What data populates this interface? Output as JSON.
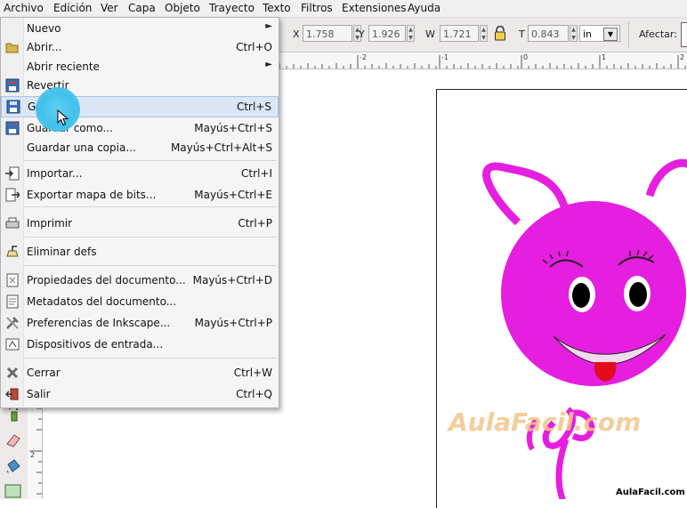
{
  "menubar": {
    "items": [
      "Archivo",
      "Edición",
      "Ver",
      "Capa",
      "Objeto",
      "Trayecto",
      "Texto",
      "Filtros",
      "Extensiones",
      "Ayuda"
    ]
  },
  "toolbar": {
    "x_label": "X",
    "x_value": "1.758",
    "y_label": "Y",
    "y_value": "1.926",
    "w_label": "W",
    "w_value": "1.721",
    "h_label": "T",
    "h_value": "0.843",
    "unit": "in",
    "affect_label": "Afectar:"
  },
  "ruler": {
    "h_labels": [
      "-2",
      "-1",
      "0",
      "1",
      "2"
    ],
    "v_labels": [
      "2"
    ]
  },
  "menu": {
    "items": [
      {
        "label": "Nuevo",
        "shortcut": "",
        "submenu": true,
        "icon": "none"
      },
      {
        "label": "Abrir...",
        "shortcut": "Ctrl+O",
        "submenu": false,
        "icon": "folder-open-icon"
      },
      {
        "label": "Abrir reciente",
        "shortcut": "",
        "submenu": true,
        "icon": "none"
      },
      {
        "label": "Revertir",
        "shortcut": "",
        "submenu": false,
        "icon": "revert-icon"
      },
      {
        "label": "Guardar",
        "shortcut": "Ctrl+S",
        "submenu": false,
        "icon": "save-icon",
        "highlighted": true
      },
      {
        "label": "Guardar como...",
        "shortcut": "Mayús+Ctrl+S",
        "submenu": false,
        "icon": "save-as-icon"
      },
      {
        "label": "Guardar una copia...",
        "shortcut": "Mayús+Ctrl+Alt+S",
        "submenu": false,
        "icon": "none"
      },
      {
        "label": "Importar...",
        "shortcut": "Ctrl+I",
        "submenu": false,
        "icon": "import-icon"
      },
      {
        "label": "Exportar mapa de bits...",
        "shortcut": "Mayús+Ctrl+E",
        "submenu": false,
        "icon": "export-icon"
      },
      {
        "label": "Imprimir",
        "shortcut": "Ctrl+P",
        "submenu": false,
        "icon": "print-icon"
      },
      {
        "label": "Eliminar defs",
        "shortcut": "",
        "submenu": false,
        "icon": "vacuum-defs-icon"
      },
      {
        "label": "Propiedades del documento...",
        "shortcut": "Mayús+Ctrl+D",
        "submenu": false,
        "icon": "document-properties-icon"
      },
      {
        "label": "Metadatos del documento...",
        "shortcut": "",
        "submenu": false,
        "icon": "metadata-icon"
      },
      {
        "label": "Preferencias de Inkscape...",
        "shortcut": "Mayús+Ctrl+P",
        "submenu": false,
        "icon": "preferences-icon"
      },
      {
        "label": "Dispositivos de entrada...",
        "shortcut": "",
        "submenu": false,
        "icon": "input-devices-icon"
      },
      {
        "label": "Cerrar",
        "shortcut": "Ctrl+W",
        "submenu": false,
        "icon": "close-icon"
      },
      {
        "label": "Salir",
        "shortcut": "Ctrl+Q",
        "submenu": false,
        "icon": "quit-icon"
      }
    ]
  },
  "canvas": {
    "watermark": "AulaFacil.com",
    "brand": "AulaFacil.com"
  },
  "colors": {
    "accent_magenta": "#e61ee0",
    "highlight": "#dbe6f4",
    "click_indicator": "#42c1ec"
  }
}
